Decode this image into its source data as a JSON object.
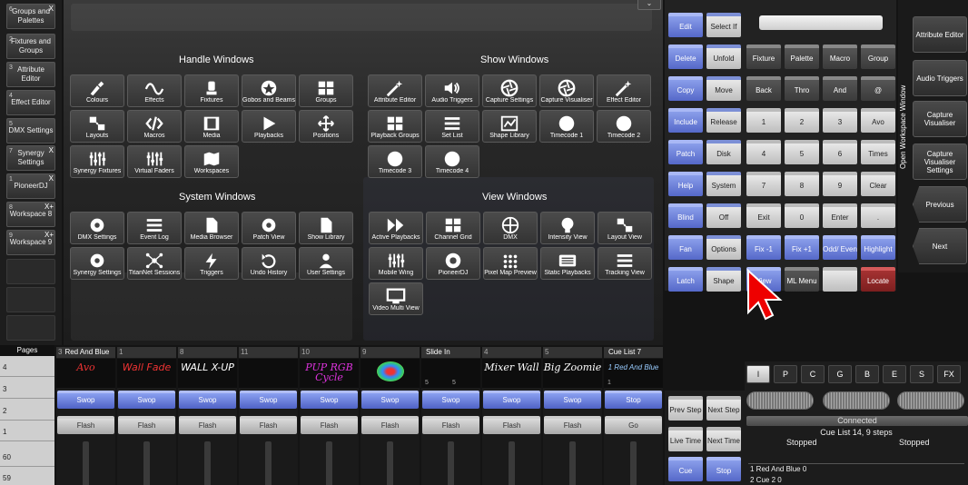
{
  "workspaces": [
    {
      "num": "6",
      "label": "Groups and Palettes",
      "close": "X"
    },
    {
      "num": "2",
      "label": "Fixtures and Groups",
      "close": ""
    },
    {
      "num": "3",
      "label": "Attribute Editor",
      "close": ""
    },
    {
      "num": "4",
      "label": "Effect Editor",
      "close": ""
    },
    {
      "num": "5",
      "label": "DMX Settings",
      "close": ""
    },
    {
      "num": "7",
      "label": "Synergy Settings",
      "close": "X"
    },
    {
      "num": "1",
      "label": "PioneerDJ",
      "close": "X"
    },
    {
      "num": "8",
      "label": "Workspace 8",
      "close": "X+"
    },
    {
      "num": "9",
      "label": "Workspace 9",
      "close": "X+"
    }
  ],
  "menu": {
    "dropdown": "⌄",
    "sections": {
      "handle": "Handle Windows",
      "show": "Show Windows",
      "system": "System Windows",
      "view": "View Windows"
    },
    "handle": [
      "Colours",
      "Effects",
      "Fixtures",
      "Gobos and Beams",
      "Groups",
      "Layouts",
      "Macros",
      "Media",
      "Playbacks",
      "Positions",
      "Synergy Fixtures",
      "Virtual Faders",
      "Workspaces"
    ],
    "show": [
      "Attribute Editor",
      "Audio Triggers",
      "Capture Settings",
      "Capture Visualiser",
      "Effect Editor",
      "Playback Groups",
      "Set List",
      "Shape Library",
      "Timecode 1",
      "Timecode 2",
      "Timecode 3",
      "Timecode 4"
    ],
    "system": [
      "DMX Settings",
      "Event Log",
      "Media Browser",
      "Patch View",
      "Show Library",
      "Synergy Settings",
      "TitanNet Sessions",
      "Triggers",
      "Undo History",
      "User Settings"
    ],
    "view": [
      "Active Playbacks",
      "Channel Grid",
      "DMX",
      "Intensity View",
      "Layout View",
      "Mobile Wing",
      "PioneerDJ",
      "Pixel Map Preview",
      "Static Playbacks",
      "Tracking View",
      "Video Multi View"
    ]
  },
  "keys": {
    "left": [
      [
        "Edit",
        "Select If"
      ],
      [
        "Delete",
        "Unfold"
      ],
      [
        "Copy",
        "Move"
      ],
      [
        "Include",
        "Release"
      ],
      [
        "Patch",
        "Disk"
      ],
      [
        "Help",
        "System"
      ],
      [
        "Blind",
        "Off"
      ],
      [
        "Fan",
        "Options"
      ],
      [
        "Latch",
        "Shape"
      ]
    ],
    "row1": [
      "Fixture",
      "Palette",
      "Macro",
      "Group"
    ],
    "row2": [
      "Back",
      "Thro",
      "And",
      "@"
    ],
    "row3": [
      "1",
      "2",
      "3",
      "Avo"
    ],
    "row4": [
      "4",
      "5",
      "6",
      "Times"
    ],
    "row5": [
      "7",
      "8",
      "9",
      "Clear"
    ],
    "row6": [
      "Exit",
      "0",
      "Enter",
      "."
    ],
    "row7": [
      "Fix -1",
      "Fix +1",
      "Odd/ Even",
      "Highlight"
    ],
    "row8": [
      "View",
      "ML Menu",
      "",
      "Locate"
    ]
  },
  "right": {
    "vertical": "Open Workspace Window",
    "buttons": [
      "Attribute Editor",
      "Audio Triggers",
      "Capture Visualiser",
      "Capture Visualiser Settings",
      "Previous",
      "Next"
    ]
  },
  "pages": {
    "label": "Pages",
    "numbers": [
      "4",
      "3",
      "2",
      "1",
      "60",
      "59"
    ]
  },
  "playbacks": [
    {
      "num": "3",
      "name": "Red And Blue",
      "art": "Avo",
      "swop": "Swop",
      "flash": "Flash"
    },
    {
      "num": "1",
      "name": "",
      "art": "Wall Fade",
      "swop": "Swop",
      "flash": "Flash"
    },
    {
      "num": "8",
      "name": "",
      "art": "WALL X-UP",
      "swop": "Swop",
      "flash": "Flash"
    },
    {
      "num": "11",
      "name": "",
      "art": "",
      "swop": "Swop",
      "flash": "Flash"
    },
    {
      "num": "10",
      "name": "",
      "art": "PUP RGB Cycle",
      "swop": "Swop",
      "flash": "Flash"
    },
    {
      "num": "9",
      "name": "",
      "art": "",
      "swop": "Swop",
      "flash": "Flash"
    },
    {
      "num": "",
      "name": "Slide In",
      "art": "",
      "swop": "Swop",
      "flash": "Flash",
      "marks": [
        "5",
        "5"
      ]
    },
    {
      "num": "4",
      "name": "",
      "art": "Mixer Wall",
      "swop": "Swop",
      "flash": "Flash"
    },
    {
      "num": "5",
      "name": "",
      "art": "Big Zoomie",
      "swop": "Swop",
      "flash": "Flash"
    },
    {
      "num": "",
      "name": "Cue List 7",
      "art": "1 Red And Blue",
      "swop": "Stop",
      "flash": "Go",
      "marks": [
        "1"
      ]
    }
  ],
  "pbkeys": [
    [
      "Prev Step",
      "Next Step"
    ],
    [
      "Live Time",
      "Next Time"
    ],
    [
      "Cue",
      "Stop"
    ]
  ],
  "status": {
    "tabs": [
      "I",
      "P",
      "C",
      "G",
      "B",
      "E",
      "S",
      "FX"
    ],
    "connected": "Connected",
    "cuelist": "Cue List 14, 9 steps",
    "left_state": "Stopped",
    "right_state": "Stopped",
    "cues": [
      "1  Red And Blue  0",
      "2  Cue 2  0"
    ]
  },
  "colors": {
    "accent": "#6f84e0",
    "red": "#a53232"
  }
}
